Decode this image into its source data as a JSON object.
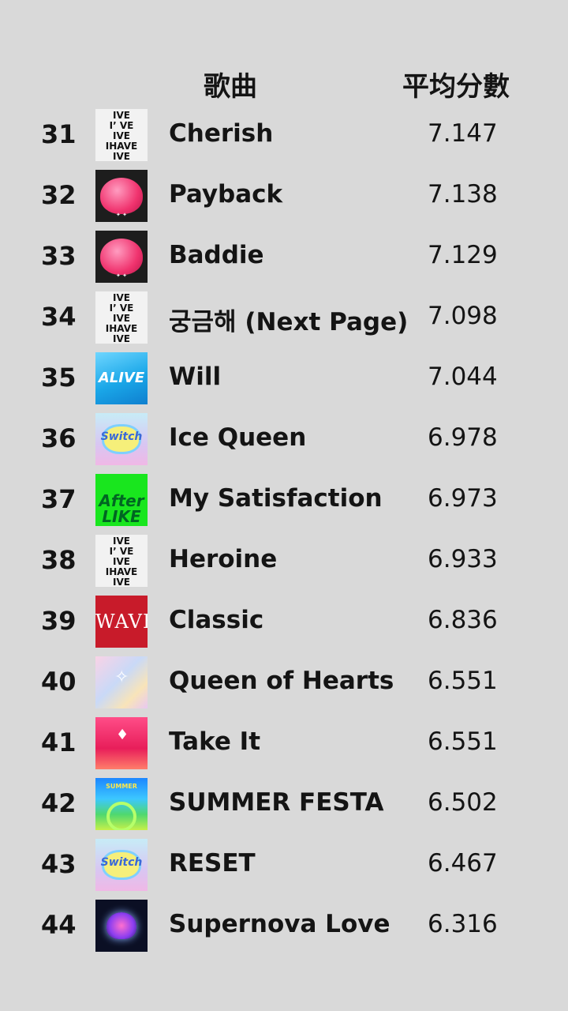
{
  "header": {
    "song_label": "歌曲",
    "score_label": "平均分數"
  },
  "rows": [
    {
      "rank": "31",
      "title": "Cherish",
      "score": "7.147",
      "cover": "ive-album-cover"
    },
    {
      "rank": "32",
      "title": "Payback",
      "score": "7.138",
      "cover": "heart-album-cover"
    },
    {
      "rank": "33",
      "title": "Baddie",
      "score": "7.129",
      "cover": "heart-album-cover"
    },
    {
      "rank": "34",
      "title": "궁금해 (Next Page)",
      "score": "7.098",
      "cover": "ive-album-cover"
    },
    {
      "rank": "35",
      "title": "Will",
      "score": "7.044",
      "cover": "alive-album-cover"
    },
    {
      "rank": "36",
      "title": "Ice Queen",
      "score": "6.978",
      "cover": "switch-album-cover"
    },
    {
      "rank": "37",
      "title": "My Satisfaction",
      "score": "6.973",
      "cover": "after-album-cover"
    },
    {
      "rank": "38",
      "title": "Heroine",
      "score": "6.933",
      "cover": "ive-album-cover"
    },
    {
      "rank": "39",
      "title": "Classic",
      "score": "6.836",
      "cover": "wave-album-cover"
    },
    {
      "rank": "40",
      "title": "Queen of Hearts",
      "score": "6.551",
      "cover": "pastel-album-cover"
    },
    {
      "rank": "41",
      "title": "Take It",
      "score": "6.551",
      "cover": "takeit-album-cover"
    },
    {
      "rank": "42",
      "title": "SUMMER FESTA",
      "score": "6.502",
      "cover": "festa-album-cover"
    },
    {
      "rank": "43",
      "title": "RESET",
      "score": "6.467",
      "cover": "switch-album-cover"
    },
    {
      "rank": "44",
      "title": "Supernova Love",
      "score": "6.316",
      "cover": "nova-album-cover"
    }
  ]
}
